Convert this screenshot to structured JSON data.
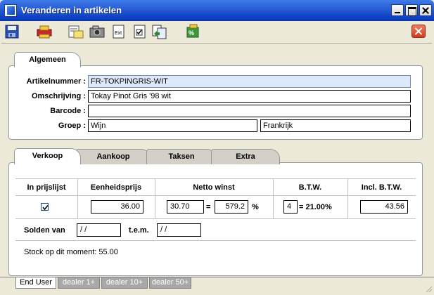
{
  "window": {
    "title": "Veranderen in artikelen"
  },
  "toolbar": {
    "icons": [
      "save-icon",
      "print-icon",
      "notes-icon",
      "camera-icon",
      "export-icon",
      "checklist-icon",
      "copy-icon",
      "calculator-icon",
      "close-icon"
    ]
  },
  "top_tab": {
    "label": "Algemeen"
  },
  "general": {
    "artikelnummer_label": "Artikelnummer :",
    "artikelnummer_value": "FR-TOKPINGRIS-WIT",
    "omschrijving_label": "Omschrijving :",
    "omschrijving_value": "Tokay Pinot Gris '98 wit",
    "barcode_label": "Barcode :",
    "barcode_value": "",
    "groep_label": "Groep :",
    "groep_value": "Wijn",
    "groep_sub_value": "Frankrijk"
  },
  "tabs": [
    {
      "label": "Verkoop"
    },
    {
      "label": "Aankoop"
    },
    {
      "label": "Taksen"
    },
    {
      "label": "Extra"
    }
  ],
  "sales": {
    "headers": [
      "In prijslijst",
      "Eenheidsprijs",
      "Netto winst",
      "B.T.W.",
      "Incl. B.T.W."
    ],
    "in_prijslijst_checked": true,
    "eenheidsprijs": "36.00",
    "netto_winst_pct": "30.70",
    "equals1": "=",
    "netto_winst_amount": "579.2",
    "percent_sign": "%",
    "btw_code": "4",
    "btw_rate": "= 21.00%",
    "incl_btw": "43.56",
    "solden_van_label": "Solden van",
    "solden_van_value": "/ /",
    "tem_label": "t.e.m.",
    "tem_value": "/ /",
    "stock_text": "Stock op dit moment: 55.00"
  },
  "bottom_tabs": [
    "End User",
    "dealer 1+",
    "dealer 10+",
    "dealer 50+"
  ],
  "colors": {
    "title_bar": "#0b3fc2",
    "active_tab": "#ffffff",
    "inactive_tab": "#d4d0c8",
    "highlight_field": "#dde8f8"
  }
}
